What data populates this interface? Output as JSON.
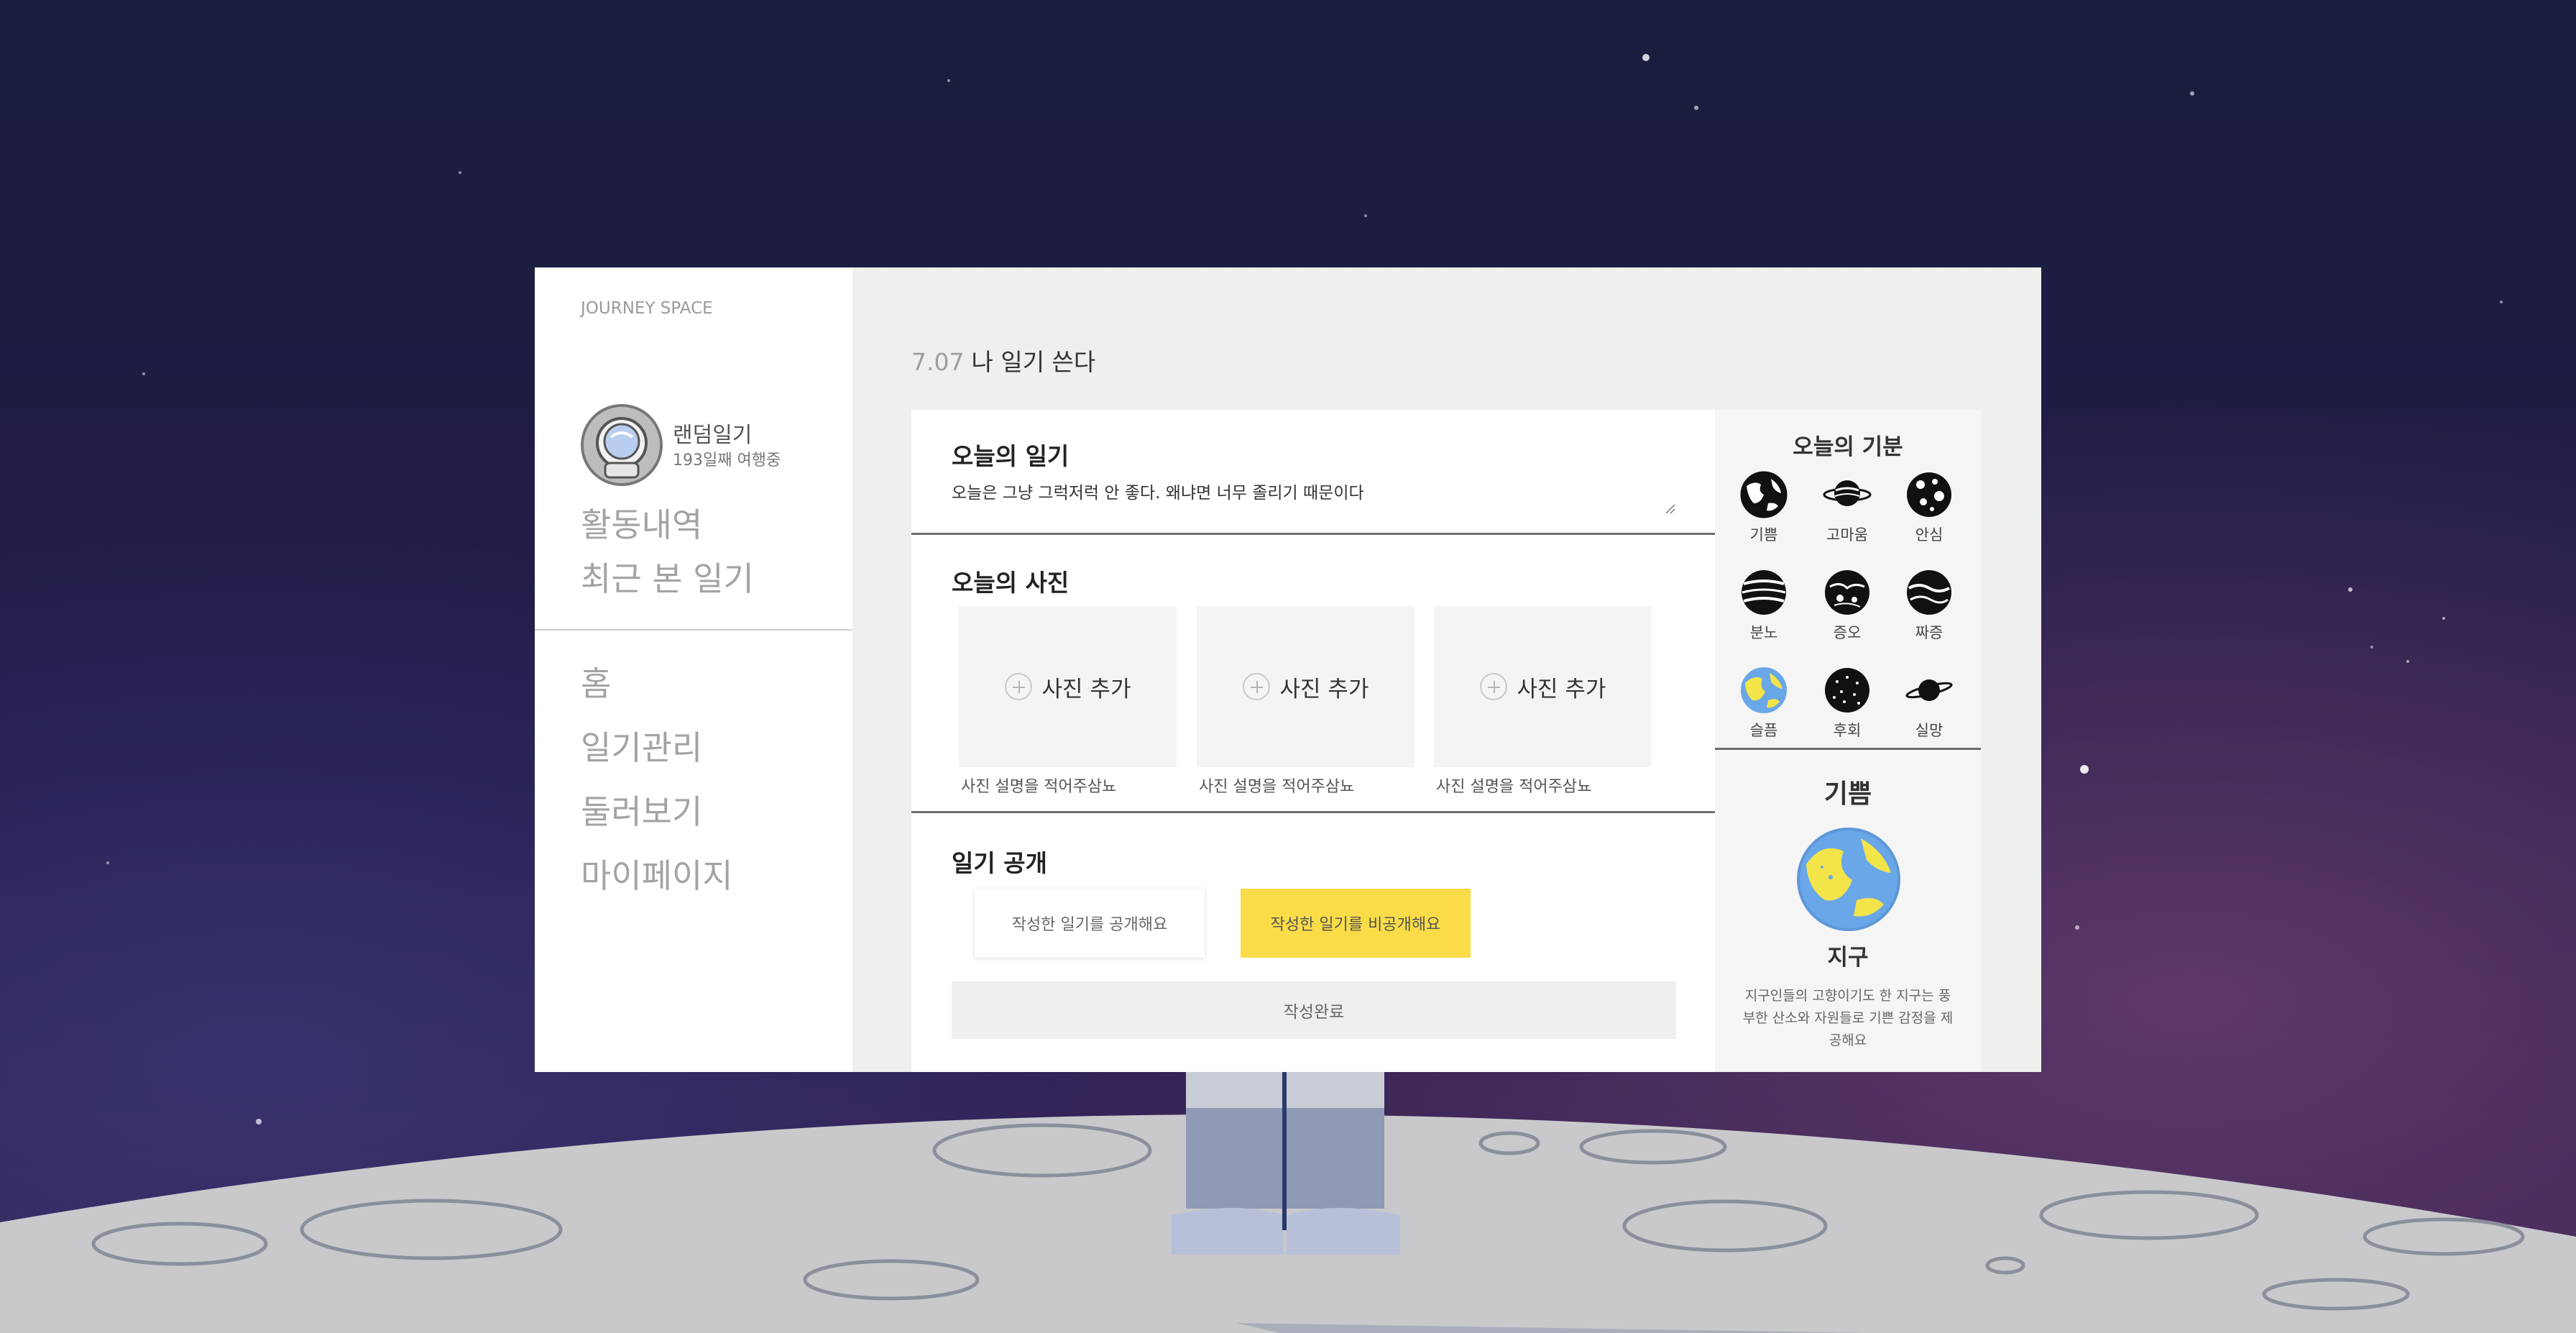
{
  "app": {
    "brand": "JOURNEY SPACE"
  },
  "profile": {
    "name": "랜덤일기",
    "days": "193일째 여행중"
  },
  "sidebar": {
    "top_links": [
      {
        "label": "활동내역"
      },
      {
        "label": "최근 본 일기"
      }
    ],
    "nav_links": [
      {
        "label": "홈"
      },
      {
        "label": "일기관리"
      },
      {
        "label": "둘러보기"
      },
      {
        "label": "마이페이지"
      }
    ]
  },
  "header": {
    "date": "7.07",
    "title": "나 일기 쓴다"
  },
  "diary": {
    "section_title": "오늘의 일기",
    "text": "오늘은 그냥 그럭저럭 안 좋다. 왜냐면 너무 졸리기 때문이다"
  },
  "photos": {
    "section_title": "오늘의 사진",
    "slots": [
      {
        "add_label": "사진 추가",
        "caption": "사진 설명을 적어주삼뇨"
      },
      {
        "add_label": "사진 추가",
        "caption": "사진 설명을 적어주삼뇨"
      },
      {
        "add_label": "사진 추가",
        "caption": "사진 설명을 적어주삼뇨"
      }
    ]
  },
  "visibility": {
    "section_title": "일기 공개",
    "public_label": "작성한 일기를 공개해요",
    "private_label": "작성한 일기를 비공개해요",
    "selected": "private",
    "submit_label": "작성완료"
  },
  "mood": {
    "title": "오늘의 기분",
    "items": [
      {
        "label": "기쁨",
        "icon": "planet-earth-icon"
      },
      {
        "label": "고마움",
        "icon": "planet-ringed-icon"
      },
      {
        "label": "안심",
        "icon": "planet-spotted-icon"
      },
      {
        "label": "분노",
        "icon": "planet-striped-icon"
      },
      {
        "label": "증오",
        "icon": "planet-cratered-icon"
      },
      {
        "label": "짜증",
        "icon": "planet-wavy-icon"
      },
      {
        "label": "슬픔",
        "icon": "planet-earth-color-icon"
      },
      {
        "label": "후회",
        "icon": "planet-dotted-icon"
      },
      {
        "label": "실망",
        "icon": "planet-saturn-icon"
      }
    ],
    "selected": {
      "emotion": "기쁨",
      "planet": "지구",
      "description": "지구인들의 고향이기도 한 지구는 풍부한 산소와 자원들로 기쁜 감정을 제공해요"
    },
    "colors": {
      "earth_ocean": "#6aa7e8",
      "earth_land": "#f3e44a",
      "accent_yellow": "#f9dc47"
    }
  }
}
